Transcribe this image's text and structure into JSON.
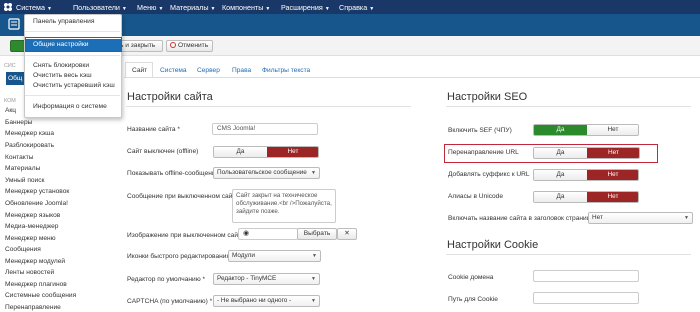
{
  "nav": {
    "items": [
      "Система",
      "Пользователи",
      "Меню",
      "Материалы",
      "Компоненты",
      "Расширения",
      "Справка"
    ]
  },
  "dropdown": {
    "items": [
      "Панель управления",
      "Общие настройки",
      "Снять блокировки",
      "Очистить весь кэш",
      "Очистить устаревший кэш",
      "Информация о системе"
    ]
  },
  "toolbar": {
    "save_close_label": "ь и закрыть",
    "cancel_label": "Отменить"
  },
  "sidebar": {
    "head1": "СИС",
    "active": "Общ",
    "head2": "КОМ",
    "items": [
      "Акц",
      "Баннеры",
      "Менеджер кэша",
      "Разблокировать",
      "Контакты",
      "Материалы",
      "Умный поиск",
      "Менеджер установок",
      "Обновление Joomla!",
      "Менеджер языков",
      "Медиа-менеджер",
      "Менеджер меню",
      "Сообщения",
      "Менеджер модулей",
      "Ленты новостей",
      "Менеджер плагинов",
      "Системные сообщения",
      "Перенаправление"
    ]
  },
  "tabs": [
    "Сайт",
    "Система",
    "Сервер",
    "Права",
    "Фильтры текста"
  ],
  "site": {
    "title": "Настройки сайта",
    "site_name_label": "Название сайта *",
    "site_name_value": "CMS Joomla!",
    "offline_label": "Сайт выключен (offline)",
    "offline_yes": "Да",
    "offline_no": "Нет",
    "offline_msg_label": "Показывать offline-сообщение",
    "offline_msg_value": "Пользовательское сообщение",
    "offline_text_label": "Сообщение при выключенном сайте",
    "offline_text_value": "Сайт закрыт на техническое обслуживание.<br />Пожалуйста, зайдите позже.",
    "offline_image_label": "Изображение при выключенном сайте",
    "offline_image_button": "Выбрать",
    "offline_image_clear": "✕",
    "quickicon_label": "Иконки быстрого редактирования",
    "quickicon_value": "Модули",
    "editor_label": "Редактор по умолчанию *",
    "editor_value": "Редактор - TinyMCE",
    "captcha_label": "CAPTCHA (по умолчанию) *",
    "captcha_value": "- Не выбрано ни одного -"
  },
  "seo": {
    "title": "Настройки SEO",
    "sef_label": "Включить SEF (ЧПУ)",
    "rewrite_label": "Перенаправление URL",
    "suffix_label": "Добавлять суффикс к URL",
    "unicode_label": "Алиасы в Unicode",
    "sitename_label": "Включать название сайта в заголовок страницы",
    "sitename_value": "Нет",
    "yes": "Да",
    "no": "Нет"
  },
  "cookie": {
    "title": "Настройки Cookie",
    "domain_label": "Cookie домена",
    "path_label": "Путь для Cookie"
  },
  "colors": {
    "navbar": "#1a3867",
    "header": "#17568c",
    "red": "#9c2525",
    "green": "#2b8a2b",
    "highlight": "#c2273b"
  }
}
